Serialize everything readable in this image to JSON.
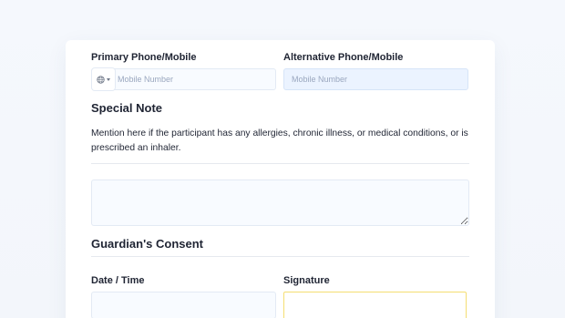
{
  "phone": {
    "primary_label": "Primary Phone/Mobile",
    "primary_placeholder": "Mobile Number",
    "alternative_label": "Alternative Phone/Mobile",
    "alternative_placeholder": "Mobile Number"
  },
  "special_note": {
    "title": "Special Note",
    "description": "Mention here if the participant has any allergies, chronic illness, or medical conditions, or is prescribed an inhaler."
  },
  "guardian_consent": {
    "title": "Guardian's Consent",
    "date_time_label": "Date / Time",
    "signature_label": "Signature"
  },
  "icons": {
    "country_selector": "globe-icon",
    "dropdown": "caret-down-icon"
  },
  "colors": {
    "page_background": "#f3f6fb",
    "card_background": "#ffffff",
    "input_background": "#f8fbff",
    "alt_input_background": "#ebf3ff",
    "signature_border": "#f5de72",
    "text": "#1f2433",
    "placeholder": "#9aa7bf"
  }
}
